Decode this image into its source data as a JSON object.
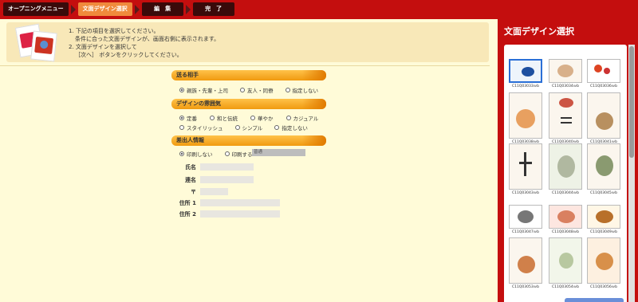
{
  "breadcrumb": {
    "steps": [
      {
        "label": "オープニングメニュー"
      },
      {
        "label": "文面デザイン選択"
      },
      {
        "label": "編　集"
      },
      {
        "label": "完　了"
      }
    ]
  },
  "instructions": {
    "line1": "1. 下記の項目を選択してください。",
    "line2": "条件に合った文面デザインが、画面右側に表示されます。",
    "line3": "2. 文面デザインを選択して",
    "line4": "［次へ］ ボタンをクリックしてください。"
  },
  "recipient": {
    "header": "送る相手",
    "options": [
      "親族・先輩・上司",
      "友人・同僚",
      "指定しない"
    ],
    "selected": 0
  },
  "atmosphere": {
    "header": "デザインの雰囲気",
    "row1": [
      "定番",
      "和と伝統",
      "華やか",
      "カジュアル"
    ],
    "row2": [
      "スタイリッシュ",
      "シンプル",
      "指定しない"
    ],
    "selected": 0
  },
  "sender": {
    "header": "差出人情報",
    "options": [
      "印刷しない",
      "印刷する"
    ],
    "selected": 0,
    "select_value": "普通",
    "fields": {
      "name_label": "氏名",
      "joint_label": "連名",
      "zip_label": "〒",
      "address1_label": "住所 1",
      "address2_label": "住所 2"
    }
  },
  "panel": {
    "title": "文面デザイン選択",
    "designs": [
      {
        "code": "C11Q03033ｗb",
        "selected": true
      },
      {
        "code": "C11Q03034ｗb"
      },
      {
        "code": "C11Q03036ｗb"
      },
      {
        "code": "C11Q03038ｗb"
      },
      {
        "code": "C11Q03040ｗb"
      },
      {
        "code": "C11Q03041ｗb"
      },
      {
        "code": "C11Q03043ｗb"
      },
      {
        "code": "C11Q03044ｗb"
      },
      {
        "code": "C11Q03045ｗb"
      },
      {
        "code": "C11Q03047ｗb"
      },
      {
        "code": "C11Q03048ｗb"
      },
      {
        "code": "C11Q03049ｗb"
      },
      {
        "code": "C11Q03053ｗb"
      },
      {
        "code": "C11Q03054ｗb"
      },
      {
        "code": "C11Q03056ｗb"
      }
    ]
  },
  "colors": {
    "accent": "#c40e0e",
    "section": "#f4a522",
    "background": "#fffbd8"
  }
}
